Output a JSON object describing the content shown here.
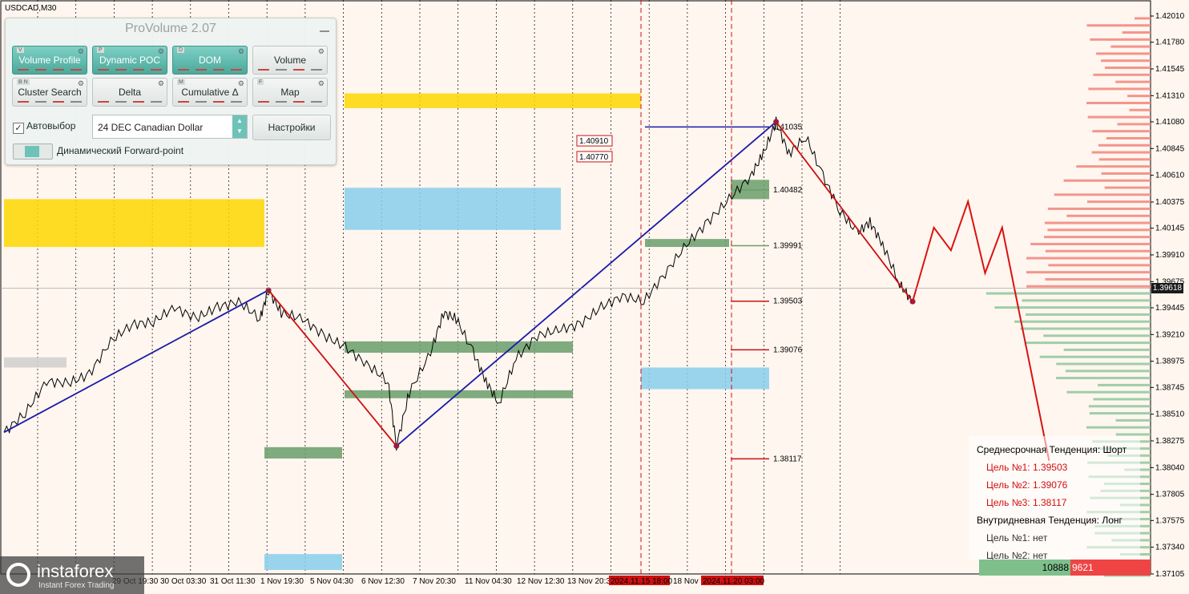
{
  "chart_data": {
    "type": "candlestick",
    "symbol": "USDCAD,M30",
    "y_ticks": [
      "1.42010",
      "1.41780",
      "1.41545",
      "1.41310",
      "1.41080",
      "1.40845",
      "1.40610",
      "1.40375",
      "1.40145",
      "1.39910",
      "1.39675",
      "1.39445",
      "1.39210",
      "1.38975",
      "1.38745",
      "1.38510",
      "1.38275",
      "1.38040",
      "1.37805",
      "1.37575",
      "1.37340",
      "1.37105"
    ],
    "x_ticks": [
      "29 Oct 19:30",
      "30 Oct 03:30",
      "31 Oct 11:30",
      "1 Nov 19:30",
      "5 Nov 04:30",
      "6 Nov 12:30",
      "7 Nov 20:30",
      "11 Nov 04:30",
      "12 Nov 12:30",
      "13 Nov 20:30",
      "2024.11.15 18:00",
      "18 Nov 1",
      "2024.11.20 03:00"
    ],
    "current_price": "1.39618",
    "level_labels": [
      "1.41035",
      "1.40482",
      "1.39991",
      "1.39503",
      "1.39076",
      "1.38117"
    ],
    "chart_labels": [
      "1.40910",
      "1.40770"
    ],
    "grid": true,
    "price_path": [
      [
        0,
        1.3835
      ],
      [
        5,
        1.3852
      ],
      [
        10,
        1.388
      ],
      [
        15,
        1.3878
      ],
      [
        20,
        1.3886
      ],
      [
        25,
        1.3915
      ],
      [
        30,
        1.393
      ],
      [
        35,
        1.3932
      ],
      [
        40,
        1.3945
      ],
      [
        45,
        1.3935
      ],
      [
        50,
        1.3945
      ],
      [
        55,
        1.395
      ],
      [
        60,
        1.3935
      ],
      [
        62,
        1.396
      ],
      [
        65,
        1.394
      ],
      [
        70,
        1.3935
      ],
      [
        75,
        1.392
      ],
      [
        80,
        1.391
      ],
      [
        85,
        1.3895
      ],
      [
        90,
        1.388
      ],
      [
        92,
        1.3823
      ],
      [
        95,
        1.387
      ],
      [
        100,
        1.3905
      ],
      [
        103,
        1.394
      ],
      [
        106,
        1.3935
      ],
      [
        110,
        1.3905
      ],
      [
        113,
        1.388
      ],
      [
        116,
        1.386
      ],
      [
        120,
        1.39
      ],
      [
        125,
        1.392
      ],
      [
        130,
        1.3925
      ],
      [
        135,
        1.393
      ],
      [
        140,
        1.3945
      ],
      [
        145,
        1.3955
      ],
      [
        150,
        1.395
      ],
      [
        155,
        1.3975
      ],
      [
        160,
        1.4
      ],
      [
        165,
        1.402
      ],
      [
        170,
        1.404
      ],
      [
        175,
        1.406
      ],
      [
        178,
        1.408
      ],
      [
        181,
        1.4108
      ],
      [
        184,
        1.408
      ],
      [
        188,
        1.4095
      ],
      [
        192,
        1.406
      ],
      [
        196,
        1.403
      ],
      [
        200,
        1.401
      ],
      [
        203,
        1.402
      ],
      [
        206,
        1.4
      ],
      [
        210,
        1.3965
      ],
      [
        213,
        1.395
      ]
    ],
    "forecast_path": [
      [
        213,
        1.395
      ],
      [
        218,
        1.4015
      ],
      [
        222,
        1.3995
      ],
      [
        226,
        1.4038
      ],
      [
        230,
        1.3975
      ],
      [
        234,
        1.4015
      ],
      [
        245,
        1.381
      ]
    ]
  },
  "panel": {
    "title": "ProVolume 2.07",
    "buttons": [
      {
        "label": "Volume Profile",
        "tag": "V",
        "on": true
      },
      {
        "label": "Dynamic POC",
        "tag": "P",
        "on": true
      },
      {
        "label": "DOM",
        "tag": "D",
        "on": true
      },
      {
        "label": "Volume",
        "tag": "",
        "on": false
      },
      {
        "label": "Cluster Search",
        "tag": "B N",
        "on": false
      },
      {
        "label": "Delta",
        "tag": "",
        "on": false
      },
      {
        "label": "Cumulative Δ",
        "tag": "M",
        "on": false
      },
      {
        "label": "Map",
        "tag": "F",
        "on": false
      }
    ],
    "autoselect_label": "Автовыбор",
    "instrument": "24 DEC Canadian Dollar",
    "settings_label": "Настройки",
    "forward_point_label": "Динамический Forward-point"
  },
  "trend_box": {
    "medium_title": "Среднесрочная Тенденция: Шорт",
    "target1": "Цель №1: 1.39503",
    "target2": "Цель №2: 1.39076",
    "target3": "Цель №3: 1.38117",
    "intraday_title": "Внутридневная Тенденция: Лонг",
    "intra_target1": "Цель №1: нет",
    "intra_target2": "Цель №2: нет"
  },
  "volume": {
    "buy": "10888",
    "sell": "9621"
  },
  "logo": {
    "brand": "instaforex",
    "tagline": "Instant Forex Trading"
  },
  "colors": {
    "bg": "#fff6ef",
    "yellow_zone": "#ffd700",
    "blue_zone": "#87ceeb",
    "green_zone": "#6a9e6a",
    "uptrend": "#1a1aa8",
    "downtrend": "#cc1111",
    "forecast": "#dd1111"
  }
}
